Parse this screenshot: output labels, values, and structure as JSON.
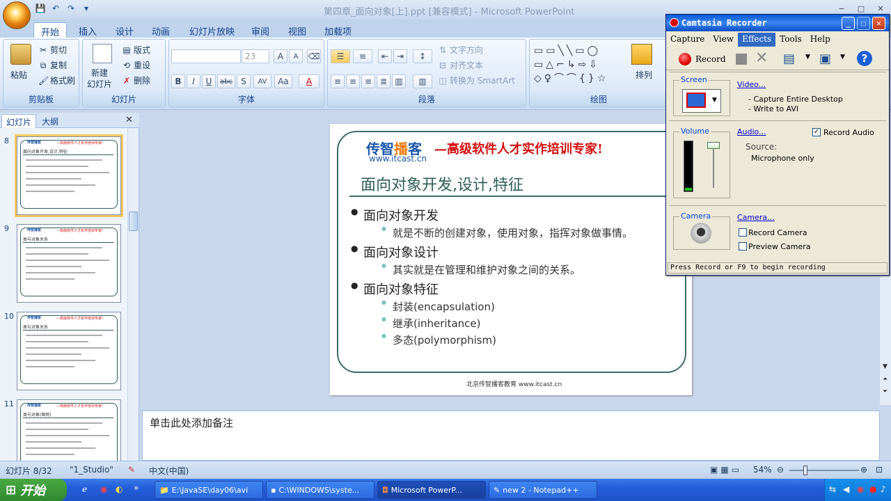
{
  "window": {
    "title": "第四章_面向对象[上].ppt [兼容模式] - Microsoft PowerPoint",
    "controls": [
      "−",
      "□",
      "✕"
    ]
  },
  "qat": {
    "save": "💾",
    "undo": "↶",
    "redo": "↷",
    "more": "▾"
  },
  "tabs": [
    "开始",
    "插入",
    "设计",
    "动画",
    "幻灯片放映",
    "审阅",
    "视图",
    "加载项"
  ],
  "ribbon": {
    "clipboard": {
      "label": "剪贴板",
      "paste": "粘贴",
      "cut": "剪切",
      "copy": "复制",
      "format_painter": "格式刷"
    },
    "slides": {
      "label": "幻灯片",
      "new_slide": "新建\n幻灯片",
      "layout": "版式",
      "reset": "重设",
      "delete": "删除"
    },
    "font": {
      "label": "字体",
      "font_name": "",
      "font_size": "23",
      "bold": "B",
      "italic": "I",
      "underline": "U",
      "strike": "abc",
      "shadow": "S",
      "spacing": "AV",
      "case": "Aa",
      "color": "A",
      "grow": "A",
      "shrink": "A"
    },
    "paragraph": {
      "label": "段落",
      "text_direction": "文字方向",
      "align_text": "对齐文本",
      "smartart": "转换为 SmartArt"
    },
    "drawing": {
      "label": "绘图",
      "arrange": "排列"
    }
  },
  "left_panel": {
    "tabs": [
      "幻灯片",
      "大纲"
    ],
    "close": "✕",
    "thumbnails": [
      {
        "num": "8",
        "head": "面向对象开发,设计,特征",
        "logo": "传智播客",
        "slogan": "—高级软件人才实作培训专家!"
      },
      {
        "num": "9",
        "head": "类与对象关系",
        "logo": "传智播客",
        "slogan": "—高级软件人才实作培训专家!"
      },
      {
        "num": "10",
        "head": "类与对象关系",
        "logo": "传智播客",
        "slogan": "—高级软件人才实作培训专家!"
      },
      {
        "num": "11",
        "head": "类与对象(图例)",
        "logo": "传智播客",
        "slogan": "—高级软件人才实作培训专家!"
      }
    ]
  },
  "slide": {
    "logo_a": "传智",
    "logo_b": "播",
    "logo_c": "客",
    "url": "www.itcast.cn",
    "slogan": "—高级软件人才实作培训专家!",
    "title": "面向对象开发,设计,特征",
    "bullets": [
      {
        "text": "面向对象开发",
        "sub": [
          "就是不断的创建对象，使用对象，指挥对象做事情。"
        ]
      },
      {
        "text": "面向对象设计",
        "sub": [
          "其实就是在管理和维护对象之间的关系。"
        ]
      },
      {
        "text": "面向对象特征",
        "sub": [
          "封装(encapsulation)",
          "继承(inheritance)",
          "多态(polymorphism)"
        ]
      }
    ],
    "footer": "北京传智播客教育 www.itcast.cn"
  },
  "notes": {
    "placeholder": "单击此处添加备注"
  },
  "status": {
    "slide_info": "幻灯片 8/32",
    "theme": "\"1_Studio\"",
    "language": "中文(中国)",
    "zoom": "54%"
  },
  "taskbar": {
    "start": "开始",
    "items": [
      "E:\\JavaSE\\day06\\avi",
      "C:\\WINDOWS\\syste...",
      "Microsoft PowerP...",
      "new  2 - Notepad++"
    ],
    "active_index": 2
  },
  "camtasia": {
    "title": "Camtasia Recorder",
    "menu": [
      "Capture",
      "View",
      "Effects",
      "Tools",
      "Help"
    ],
    "menu_highlight": "Effects",
    "record": "Record",
    "screen": {
      "label": "Screen",
      "link": "Video...",
      "lines": [
        "- Capture Entire Desktop",
        "- Write to AVI"
      ]
    },
    "volume": {
      "label": "Volume",
      "link": "Audio...",
      "record_audio": "Record Audio",
      "record_audio_checked": true,
      "source_label": "Source:",
      "source_value": "Microphone only",
      "level": 0.05
    },
    "camera": {
      "label": "Camera",
      "link": "Camera...",
      "record_camera": "Record Camera",
      "preview_camera": "Preview Camera"
    },
    "status": "Press Record or F9 to begin recording"
  },
  "colors": {
    "accent": "#15428b",
    "slide_frame": "#3b6b66",
    "slogan_red": "#d40d0d",
    "logo_blue": "#1d57a8"
  }
}
